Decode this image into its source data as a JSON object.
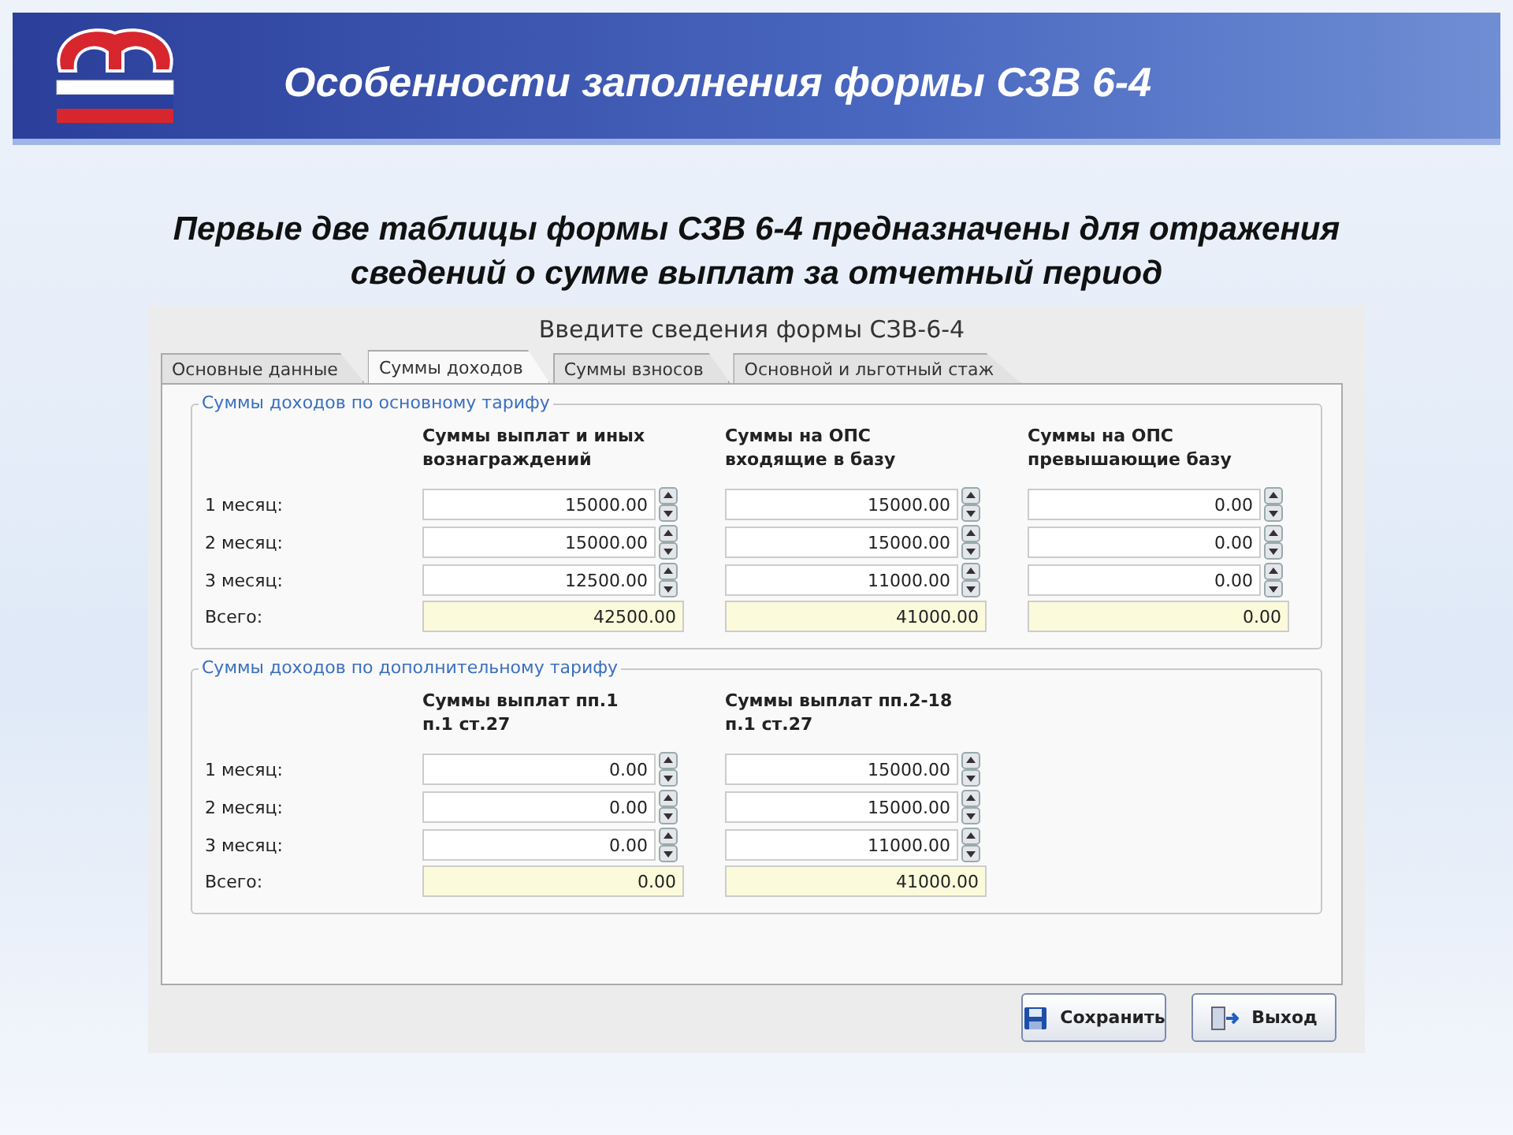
{
  "slide": {
    "title": "Особенности заполнения формы СЗВ 6-4",
    "subtitle": "Первые две таблицы формы СЗВ 6-4 предназначены для отражения сведений о сумме выплат за отчетный период"
  },
  "dialog": {
    "title": "Введите сведения формы СЗВ-6-4",
    "tabs": [
      {
        "label": "Основные данные",
        "selected": false
      },
      {
        "label": "Суммы доходов",
        "selected": true
      },
      {
        "label": "Суммы взносов",
        "selected": false
      },
      {
        "label": "Основной и льготный стаж",
        "selected": false
      }
    ],
    "groups": [
      {
        "legend": "Суммы доходов по основному тарифу",
        "columns": [
          "Суммы выплат и иных вознаграждений",
          "Суммы на ОПС входящие в базу",
          "Суммы на ОПС превышающие базу"
        ],
        "rows": [
          {
            "label": "1 месяц:",
            "kind": "input",
            "values": [
              "15000.00",
              "15000.00",
              "0.00"
            ]
          },
          {
            "label": "2 месяц:",
            "kind": "input",
            "values": [
              "15000.00",
              "15000.00",
              "0.00"
            ]
          },
          {
            "label": "3 месяц:",
            "kind": "input",
            "values": [
              "12500.00",
              "11000.00",
              "0.00"
            ]
          },
          {
            "label": "Всего:",
            "kind": "total",
            "values": [
              "42500.00",
              "41000.00",
              "0.00"
            ]
          }
        ]
      },
      {
        "legend": "Суммы доходов по дополнительному тарифу",
        "columns": [
          "Суммы выплат пп.1 п.1 ст.27",
          "Суммы выплат пп.2-18 п.1 ст.27"
        ],
        "rows": [
          {
            "label": "1 месяц:",
            "kind": "input",
            "values": [
              "0.00",
              "15000.00"
            ]
          },
          {
            "label": "2 месяц:",
            "kind": "input",
            "values": [
              "0.00",
              "15000.00"
            ]
          },
          {
            "label": "3 месяц:",
            "kind": "input",
            "values": [
              "0.00",
              "11000.00"
            ]
          },
          {
            "label": "Всего:",
            "kind": "total",
            "values": [
              "0.00",
              "41000.00"
            ]
          }
        ]
      }
    ],
    "buttons": [
      {
        "label": "Сохранить",
        "kind": "save"
      },
      {
        "label": "Выход",
        "kind": "exit"
      }
    ]
  }
}
